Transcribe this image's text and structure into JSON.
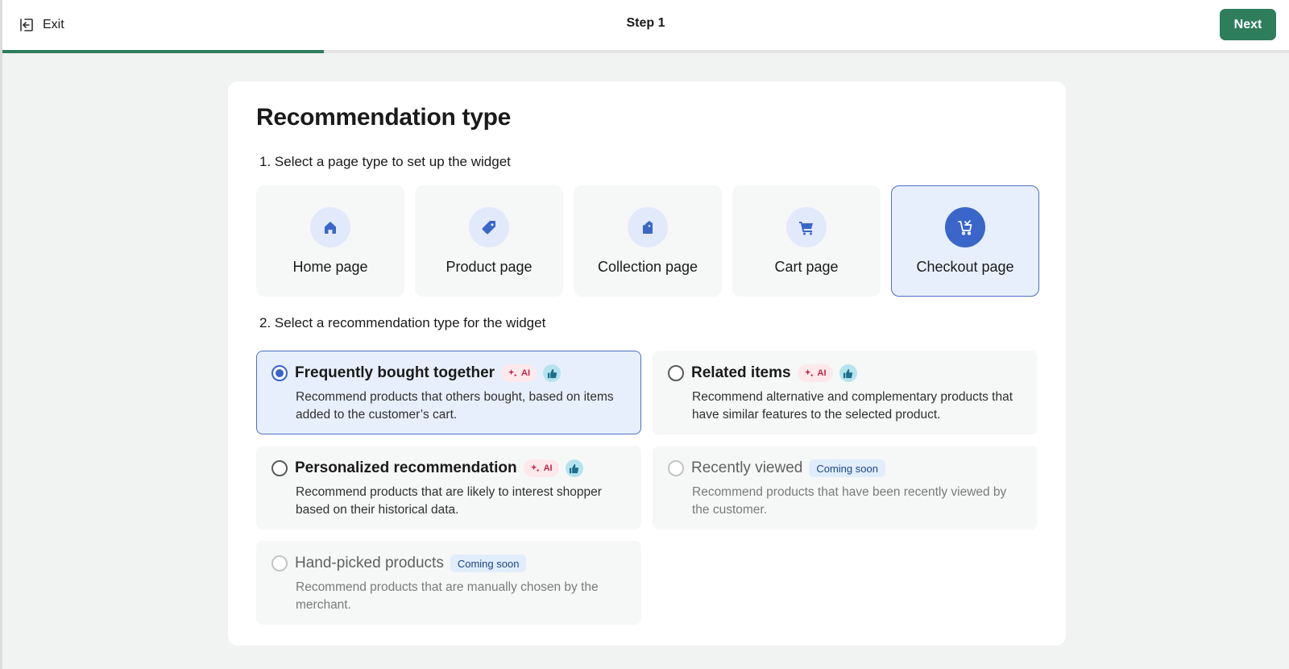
{
  "header": {
    "exit_label": "Exit",
    "step_title": "Step 1",
    "next_label": "Next",
    "progress_fraction": 0.25,
    "accent_color": "#2e7d5b"
  },
  "card": {
    "title": "Recommendation type",
    "section1_label": "1. Select a page type to set up the widget",
    "section2_label": "2. Select a recommendation type for the widget"
  },
  "page_types": [
    {
      "label": "Home page",
      "icon": "home-icon",
      "selected": false
    },
    {
      "label": "Product page",
      "icon": "tag-icon",
      "selected": false
    },
    {
      "label": "Collection page",
      "icon": "collection-tags-icon",
      "selected": false
    },
    {
      "label": "Cart page",
      "icon": "cart-icon",
      "selected": false
    },
    {
      "label": "Checkout page",
      "icon": "checkout-cart-icon",
      "selected": true
    }
  ],
  "rec_types": [
    {
      "title": "Frequently bought together",
      "desc": "Recommend products that others bought, based on items added to the customer’s cart.",
      "ai_badge": "AI",
      "thumb": true,
      "selected": true,
      "disabled": false
    },
    {
      "title": "Related items",
      "desc": "Recommend alternative and complementary products that have similar features to the selected product.",
      "ai_badge": "AI",
      "thumb": true,
      "selected": false,
      "disabled": false
    },
    {
      "title": "Personalized recommendation",
      "desc": "Recommend products that are likely to interest shopper based on their historical data.",
      "ai_badge": "AI",
      "thumb": true,
      "selected": false,
      "disabled": false
    },
    {
      "title": "Recently viewed",
      "desc": "Recommend products that have been recently viewed by the customer.",
      "soon_badge": "Coming soon",
      "selected": false,
      "disabled": true
    },
    {
      "title": "Hand-picked products",
      "desc": "Recommend products that are manually chosen by the merchant.",
      "soon_badge": "Coming soon",
      "selected": false,
      "disabled": true
    }
  ]
}
